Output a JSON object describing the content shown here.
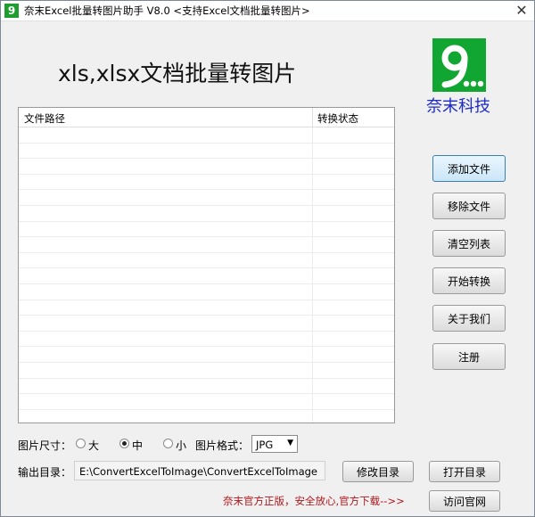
{
  "window": {
    "icon_glyph": "9",
    "title": "奈末Excel批量转图片助手 V8.0    <支持Excel文档批量转图片>",
    "close_glyph": "✕"
  },
  "header": {
    "main_title": "xls,xlsx文档批量转图片",
    "brand": "奈末科技"
  },
  "file_list": {
    "columns": [
      "文件路径",
      "转换状态"
    ],
    "rows": []
  },
  "actions": {
    "add_file": "添加文件",
    "remove_file": "移除文件",
    "clear_list": "清空列表",
    "start_convert": "开始转换",
    "about_us": "关于我们",
    "register": "注册"
  },
  "options": {
    "size_label": "图片尺寸：",
    "size_options": [
      "大",
      "中",
      "小"
    ],
    "size_selected": "中",
    "format_label": "图片格式：",
    "format_value": "JPG"
  },
  "output": {
    "label": "输出目录：",
    "path": "E:\\ConvertExcelToImage\\ConvertExcelToImage",
    "modify_button": "修改目录",
    "open_button": "打开目录"
  },
  "footer": {
    "promo": "奈末官方正版，安全放心,官方下载-->>",
    "visit_button": "访问官网"
  },
  "colors": {
    "logo_green": "#11a531",
    "brand_blue": "#1d2cc9",
    "promo_red": "#b0161b",
    "focus_blue": "#3c7fb1"
  }
}
